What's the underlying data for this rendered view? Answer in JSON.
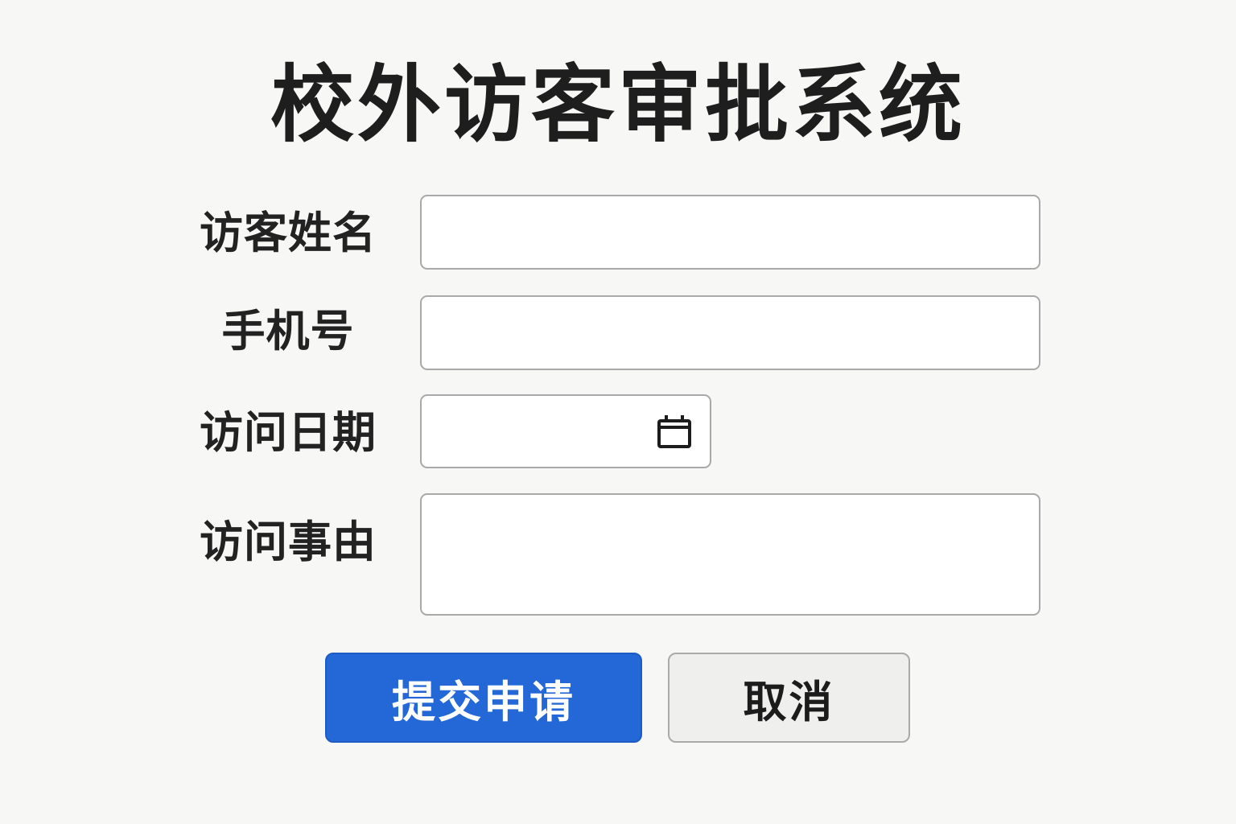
{
  "page": {
    "title": "校外访客审批系统"
  },
  "form": {
    "fields": [
      {
        "label": "访客姓名",
        "value": "",
        "placeholder": ""
      },
      {
        "label": "手机号",
        "value": "",
        "placeholder": ""
      },
      {
        "label": "访问日期",
        "value": "",
        "placeholder": "",
        "icon": "calendar-icon"
      },
      {
        "label": "访问事由",
        "value": "",
        "placeholder": ""
      }
    ]
  },
  "actions": {
    "submit_label": "提交申请",
    "cancel_label": "取消"
  },
  "colors": {
    "background": "#f7f7f5",
    "primary": "#2468d8",
    "secondary_button": "#efefed",
    "border": "#a9a9a9"
  }
}
